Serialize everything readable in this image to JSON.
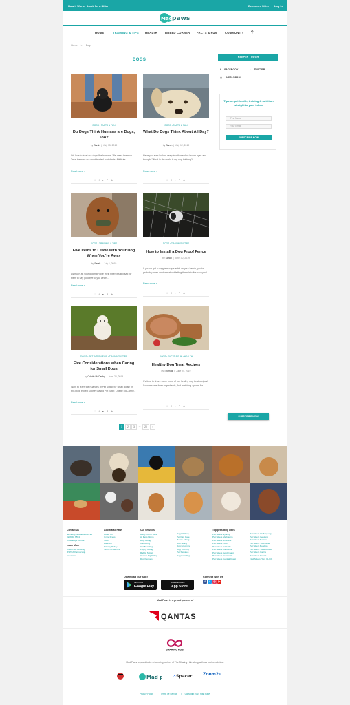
{
  "topbar": {
    "left": [
      "How it Works",
      "Look for a Sitter"
    ],
    "right": [
      "Become a Sitter",
      "Log In"
    ]
  },
  "brand": {
    "logo_left": "Mad",
    "logo_right": "paws",
    "accent": "#1aa6a6"
  },
  "nav": [
    "HOME",
    "TRAINING & TIPS",
    "HEALTH",
    "BREED CORNER",
    "FACTS & FUN",
    "COMMUNITY"
  ],
  "nav_active_index": 1,
  "breadcrumb": [
    "Home",
    ">",
    "Dogs"
  ],
  "page_title": "DOGS",
  "posts": [
    {
      "cats": "DOGS  •  FACTS & FUN",
      "title": "Do Dogs Think Humans are Dogs, Too?",
      "author": "Sarah",
      "date": "July 15, 2019",
      "excerpt": "We love to treat our dogs like humans. We dress them up. Treat them as our most trusted confidants. Attribute...",
      "more": "Read more »"
    },
    {
      "cats": "DOGS  •  FACTS & FUN",
      "title": "What Do Dogs Think About All Day?",
      "author": "Sarah",
      "date": "July 12, 2019",
      "excerpt": "Have you ever looked deep into those dark brown eyes and thought \"What in the world is my dog thinking?\"...",
      "more": "Read more »"
    },
    {
      "cats": "DOGS  •  TRAINING & TIPS",
      "title": "Five Items to Leave with Your Dog When You're Away",
      "author": "Sarah",
      "date": "July 1, 2019",
      "excerpt": "As much as your dog may love their Sitter, it's still sad for them to say goodbye to you when...",
      "more": "Read more »"
    },
    {
      "cats": "DOGS  •  TRAINING & TIPS",
      "title": "How to Install a Dog Proof Fence",
      "author": "Sarah",
      "date": "June 30, 2019",
      "excerpt": "If you've got a doggie escape artist on your hands, you've probably been cautious about letting them into the backyard...",
      "more": "Read more »"
    },
    {
      "cats": "DOGS  •  PET INTERVIEWS  •  TRAINING & TIPS",
      "title": "Five Considerations when Caring for Small Dogs",
      "author": "Odette McCarthy",
      "date": "June 26, 2019",
      "excerpt": "Want to learn the nuances of Pet Sitting for small dogs? In this blog, expert Sydney-based Pet Sitter, Odette McCarthy...",
      "more": "Read more »"
    },
    {
      "cats": "DOGS  •  FACTS & FUN  •  HEALTH",
      "title": "Healthy Dog Treat Recipes",
      "author": "Thomas",
      "date": "June 24, 2019",
      "excerpt": "It's time to share some more of our healthy dog treat recipes! Source some fresh ingredients, find matching aprons for...",
      "more": ""
    }
  ],
  "share_icons": "♡ f ♥ P ⊕",
  "byline_prefix": "by",
  "pagination": [
    "1",
    "2",
    "3",
    "...",
    "20",
    "›"
  ],
  "sidebar": {
    "keep_in_touch": "KEEP IN TOUCH",
    "social": [
      {
        "icon": "f",
        "label": "FACEBOOK"
      },
      {
        "icon": "t",
        "label": "TWITTER"
      },
      {
        "icon": "◎",
        "label": "INSTAGRAM"
      }
    ],
    "newsletter_heading": "Tips on pet health, training & nutrition straight to your inbox",
    "first_name_placeholder": "First Name",
    "email_placeholder": "Your Email",
    "subscribe": "SUBSCRIBE NOW",
    "subscribe2": "SUBSCRIBE NOW"
  },
  "footer": {
    "contact": {
      "heading": "Contact Us",
      "links": [
        "service@madpaws.com.au",
        "02 8046 6594",
        "Knowledge Centre"
      ]
    },
    "learn": {
      "heading": "Learn More",
      "links": [
        "Check out our Blog",
        "RSPCA Partnership",
        "Insurance"
      ]
    },
    "about": {
      "heading": "About Mad Paws",
      "links": [
        "About Us",
        "In the Press",
        "Jobs",
        "Partners",
        "Privacy Policy",
        "Terms Of Service"
      ]
    },
    "services": {
      "heading": "Our Services",
      "links": [
        "Away From Home",
        "At Pet's Home",
        "Dog Sitting",
        "Cat Sitting",
        "Cat Boarding",
        "Puppy Sitting",
        "Rabbit Sitting",
        "Guinea Pig Sitting",
        "Dog Kennels"
      ]
    },
    "services2": {
      "links": [
        "Dog Walking",
        "Pet Day Care",
        "House Sitting",
        "Bird Sitting",
        "Dog Grooming",
        "Dog Training",
        "Pet Services",
        "Dog Boarding"
      ]
    },
    "cities": {
      "heading": "Top pet sitting cities",
      "links": [
        "Pet Sitters Sydney",
        "Pet Sitters Melbourne",
        "Pet Sitters Brisbane",
        "Pet Sitters Perth",
        "Pet Sitters Adelaide",
        "Pet Sitters Canberra",
        "Pet Sitters Gold Coast",
        "Pet Sitters Newcastle",
        "Pet Sitters Central Coast"
      ]
    },
    "cities2": {
      "links": [
        "Pet Sitters Wollongong",
        "Pet Sitters Geelong",
        "Pet Sitters Ballarat",
        "Pet Sitters Townsville",
        "Pet Sitters Bendigo",
        "Pet Sitters Toowoomba",
        "Pet Sitters Cairns",
        "Pet Sitters Hobart",
        "Find Sitters Here CLICK"
      ]
    },
    "download": "Download our App!",
    "google_small": "GET IT ON",
    "google_big": "Google Play",
    "apple_small": "Download on the",
    "apple_big": "App Store",
    "connect": "Connect with Us",
    "proud": "Mad Paws is a proud partner of",
    "qantas": "QANTAS",
    "sharing_hub": "SHARING HUB",
    "founding": "Mad Paws is proud to be a founding partner of The Sharing Hub along with our partners below:",
    "partners": [
      "Mad paws",
      "Spacer",
      "Zoom2u"
    ],
    "bottom_links": [
      "Privacy Policy",
      "|",
      "Terms Of Service",
      "|",
      "Copyright 2019 Mad Paws"
    ]
  }
}
